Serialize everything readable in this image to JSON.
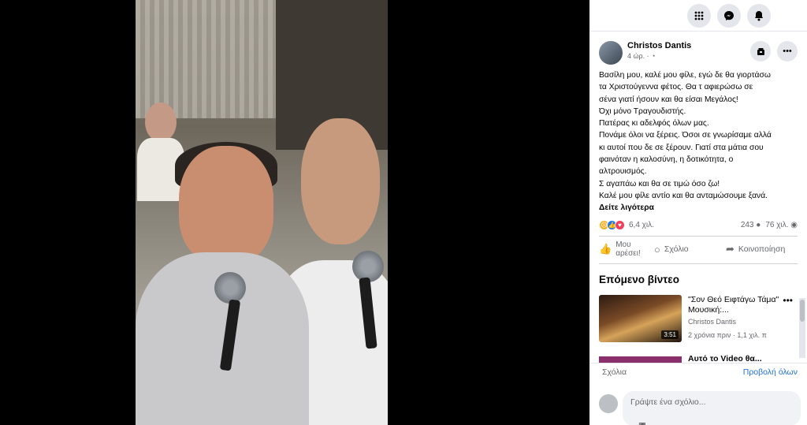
{
  "topbar": {
    "menu_icon": "grid-menu-icon",
    "messenger_icon": "messenger-icon",
    "notifications_icon": "bell-icon"
  },
  "post": {
    "author": "Christos Dantis",
    "time": "4 ώρ. · ",
    "lines": [
      "Βασίλη μου, καλέ μου φίλε, εγώ δε θα γιορτάσω",
      "τα Χριστούγεννα φέτος. Θα τ αφιερώσω σε",
      "σένα γιατί ήσουν και θα είσαι Μεγάλος!",
      "Όχι μόνο Τραγουδιστής.",
      "Πατέρας κι αδελφός όλων μας.",
      "Πονάμε όλοι να ξέρεις. Όσοι σε γνωρίσαμε αλλά",
      "κι αυτοί που δε σε ξέρουν. Γιατί στα μάτια σου",
      "φαινόταν η καλοσύνη, η δοτικότητα, ο",
      "αλτρουισμός.",
      "Σ αγαπάω και θα σε τιμώ όσο ζω!",
      "Καλέ μου φίλε αντίο και θα ανταμώσουμε ξανά."
    ],
    "see_more": "Δείτε λιγότερα",
    "reactions_count": "6,4 χιλ.",
    "comments_count": "243",
    "views_count": "76 χιλ."
  },
  "actions": {
    "like": "Μου αρέσει!",
    "comment": "Σχόλιο",
    "share": "Κοινοποίηση"
  },
  "next_videos": {
    "title": "Επόμενο βίντεο",
    "items": [
      {
        "title": "\"Σον Θεό Ειφτάγω Τάμα\" Μουσική:...",
        "author": "Christos Dantis",
        "meta": "2 χρόνια πριν · 1,1 χιλ. π",
        "duration": "3:51"
      },
      {
        "title": "Αυτό το Video θα..."
      }
    ]
  },
  "comments": {
    "label": "Σχόλια",
    "view_all": "Προβολή όλων",
    "placeholder": "Γράψτε ένα σχόλιο..."
  }
}
